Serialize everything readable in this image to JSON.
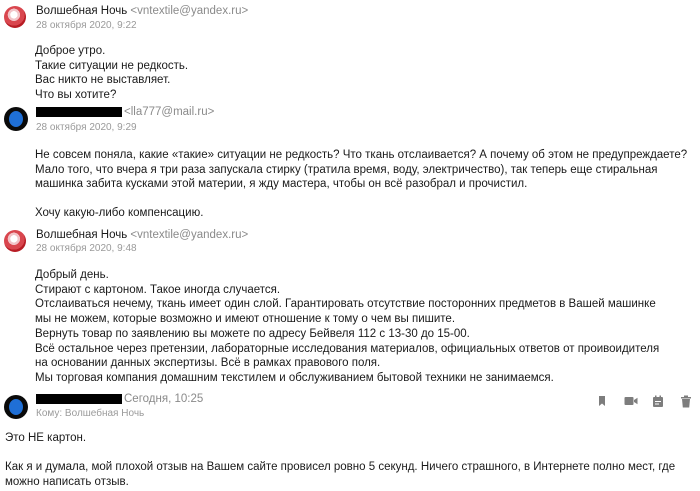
{
  "messages": [
    {
      "sender_name": "Волшебная Ночь",
      "sender_email": "<vntextile@yandex.ru>",
      "date": "28 октября 2020, 9:22",
      "lines": [
        "Доброе утро.",
        "Такие ситуации не редкость.",
        "Вас никто не выставляет.",
        "Что вы хотите?"
      ]
    },
    {
      "sender_email": "<lla777@mail.ru>",
      "date": "28 октября 2020, 9:29",
      "lines": [
        "Не совсем поняла, какие «такие» ситуации не редкость? Что ткань отслаивается? А почему об этом не предупреждаете? Мало того, что вчера я три раза запускала стирку (тратила время, воду, электричество), так теперь еще стиральная машинка забита кусками этой материи, я жду мастера, чтобы он всё разобрал и прочистил.",
        "Хочу какую-либо компенсацию."
      ]
    },
    {
      "sender_name": "Волшебная Ночь",
      "sender_email": "<vntextile@yandex.ru>",
      "date": "28 октября 2020, 9:48",
      "lines": [
        "Добрый день.",
        "Стирают с картоном. Такое иногда случается.",
        "Отслаиваться нечему, ткань имеет один слой. Гарантировать отсутствие посторонних предметов в Вашей машинке мы не можем, которые возможно и имеют отношение к тому о чем вы пишите.",
        "Вернуть товар по заявлению вы можете по адресу Бейвеля 112 с 13-30 до 15-00.",
        "Всё остальное через претензии, лабораторные исследования материалов,  официальных ответов от проивоидителя на основании данных экспертизы. Всё в рамках правового поля.",
        "Мы торговая компания домашним текстилем и обслуживанием бытовой техники не занимаемся."
      ]
    },
    {
      "date": "Сегодня, 10:25",
      "to": "Кому: Волшебная Ночь",
      "lines": [
        "Это НЕ картон.",
        "Как я и думала, мой плохой отзыв на Вашем сайте провисел ровно 5 секунд. Ничего страшного, в Интернете полно мест, где можно написать отзыв."
      ]
    }
  ],
  "toolbar_icons": [
    "bookmark-icon",
    "video-icon",
    "calendar-icon",
    "trash-icon"
  ]
}
